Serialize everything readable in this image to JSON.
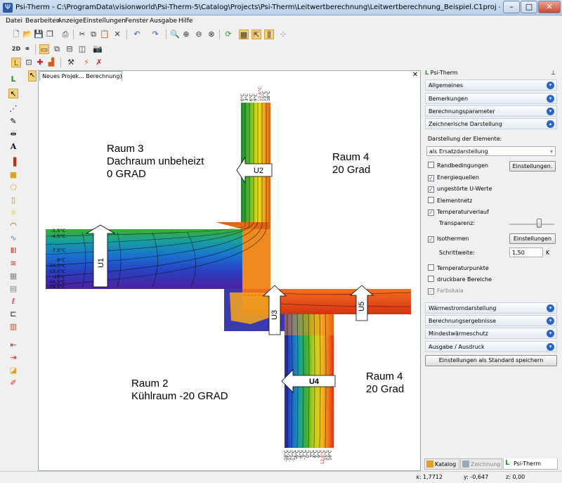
{
  "window": {
    "title": "Psi-Therm - C:\\ProgramData\\visionworld\\Psi-Therm-5\\Catalog\\Projects\\Psi-Therm\\Leitwertberechnung\\Leitwertberechnung_Beispiel.C1proj - Lizenznehmer: Visi...",
    "app_icon": "Ψ"
  },
  "menu": [
    "Datei",
    "Bearbeiten",
    "Anzeige",
    "Einstellungen",
    "Fenster",
    "Ausgabe",
    "Hilfe"
  ],
  "toolbar": {
    "btn_2d": "2D"
  },
  "document": {
    "tab_label": "Neues Projek... Berechnung)"
  },
  "drawing": {
    "rooms": {
      "raum3": "Raum 3\nDachraum unbeheizt\n0 GRAD",
      "raum4_top": "Raum 4\n20 Grad",
      "raum2": "Raum 2\nKühlraum -20 GRAD",
      "raum4_bottom": "Raum 4\n20 Grad"
    },
    "arrows": {
      "u1": "U1",
      "u2": "U2",
      "u3": "U3",
      "u4": "U4",
      "u5": "U5"
    },
    "left_scale": [
      "-1,5°C",
      "-4,5°C",
      "-7,5°C",
      "-9°C",
      "-10,5°C",
      "-13,5°C",
      "-15°C",
      "-16,5°C",
      "-19,5°C"
    ],
    "top_scale": [
      "0°C",
      "3°C",
      "6°C",
      "9°C",
      "12,6°C",
      "15°C",
      "18°C"
    ],
    "bottom_scale": [
      "-18°C",
      "-15°C",
      "-12°C",
      "-9°C",
      "-6°C",
      "-3°C",
      "0°C",
      "3°C",
      "6°C",
      "9°C",
      "12,6°C",
      "15°C",
      "18°C"
    ]
  },
  "panel": {
    "title": "Psi-Therm",
    "sections": {
      "allgemeines": "Allgemeines",
      "bemerkungen": "Bemerkungen",
      "berechnungsparameter": "Berechnungsparameter",
      "zeichnerische": "Zeichnerische Darstellung",
      "waermestrom": "Wärmestromdarstellung",
      "berechnungsergebnisse": "Berechnungsergebnisse",
      "mindest": "Mindestwärmeschutz",
      "ausgabe": "Ausgabe / Ausdruck"
    },
    "darstellung_label": "Darstellung der Elemente:",
    "darstellung_value": "als Ersatzdarstellung",
    "checks": {
      "randbedingungen": "Randbedingungen",
      "energiequellen": "Energiequellen",
      "ungestoerte": "ungestörte U-Werte",
      "elementnetz": "Elementnetz",
      "temperaturverlauf": "Temperaturverlauf",
      "isothermen": "Isothermen",
      "temperaturpunkte": "Temperaturpunkte",
      "druckbare": "druckbare Bereiche",
      "farbskala": "Farbskala"
    },
    "transparenz_label": "Transparenz:",
    "schrittweite_label": "Schrittweite:",
    "schrittweite_value": "1,50",
    "schrittweite_unit": "K",
    "btn_einstellungen1": "Einstellungen.",
    "btn_einstellungen2": "Einstellungen",
    "btn_standard": "Einstellungen als Standard speichern",
    "bottom_tabs": [
      "Katalog",
      "Zeichnung",
      "Psi-Therm"
    ]
  },
  "status": {
    "x": "x: 1,7712",
    "y": "y: -0,647",
    "z": "z: 0,00"
  }
}
